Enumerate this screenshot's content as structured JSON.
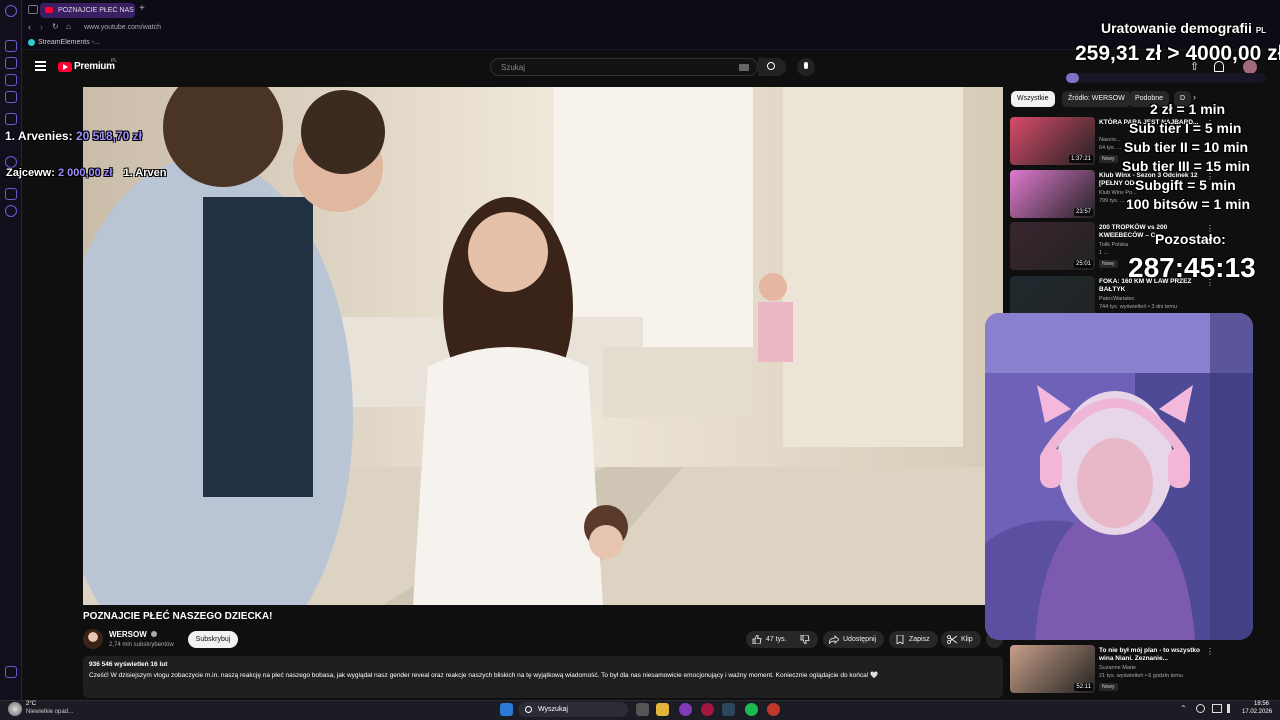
{
  "browser": {
    "tab_title": "POZNAJCIE PŁEĆ NAS",
    "url": "www.youtube.com/watch",
    "bookmark": "StreamElements -..."
  },
  "youtube": {
    "logo_text": "Premium",
    "logo_suffix": "PL",
    "search_placeholder": "Szukaj",
    "video_title": "POZNAJCIE PŁEĆ NASZEGO DZIECKA!",
    "channel_name": "WERSOW",
    "subscribers": "2,74 mln subskrybentów",
    "subscribe_label": "Subskrybuj",
    "likes": "47 tys.",
    "share_label": "Udostępnij",
    "save_label": "Zapisz",
    "clip_label": "Klip",
    "views_date": "936 546 wyświetleń  16 lut",
    "description": "Cześć! W dzisiejszym vlogu zobaczycie m.in. naszą reakcję na płeć naszego bobasa, jak wyglądał nasz gender reveal oraz reakcje naszych bliskich na tę wyjątkową wiadomość. To był dla nas niesamowicie emocjonujący i ważny moment. Koniecznie oglądajcie do końca! 🤍"
  },
  "sidebar": {
    "chips": [
      "Wszystkie",
      "Źródło: WERSOW",
      "Podobne",
      "D"
    ],
    "recs": [
      {
        "title": "KTÓRA PARA JEST NAJBARD...",
        "channel": "Nascio...",
        "meta": "64 tys. ...",
        "duration": "1:37:21",
        "badge": "Nowy"
      },
      {
        "title": "Klub Winx - Sezon 3 Odcinek 12 [PEŁNY ODC...",
        "channel": "Klub Winx Po...",
        "meta": "799 tys. ...",
        "duration": "23:57",
        "badge": ""
      },
      {
        "title": "200 TROPKÓW vs 200 KWEEBECÓW – C...",
        "channel": "Tolik Polska",
        "meta": "1 ...",
        "duration": "25:01",
        "badge": "Nowy"
      },
      {
        "title": "FOKA: 160 KM W LAW PRZEZ BAŁTYK",
        "channel": "PatecWariatec",
        "meta": "744 tys. wyświetleń • 3 dni temu",
        "duration": "",
        "badge": ""
      },
      {
        "title": "To nie był mój plan - to wszystko wina Niani. Zeznanie...",
        "channel": "Suzanne Marie",
        "meta": "21 tys. wyświetleń • 6 godzin temu",
        "duration": "52:11",
        "badge": "Nowy"
      }
    ]
  },
  "overlay": {
    "goal_title": "Uratowanie demografii",
    "goal_title_suffix": "PL",
    "goal_amount": "259,31 zł > 4000,00 zł",
    "goal_progress": 0.065,
    "top_donor_name": "1. Arvenies:",
    "top_donor_amount": "20 518,70 zł",
    "second_donor_name": "Zajceww:",
    "second_donor_amount": "2 000,00 zł",
    "ticker_tail": "1. Arven",
    "rates": [
      "2 zł = 1 min",
      "Sub tier I = 5 min",
      "Sub tier II = 10 min",
      "Sub tier III = 15 min",
      "Subgift = 5 min",
      "100 bitsów = 1 min"
    ],
    "remaining_label": "Pozostało:",
    "timer": "287:45:13"
  },
  "taskbar": {
    "weather_temp": "2°C",
    "weather_desc": "Niewielkie opad...",
    "search_label": "Wyszukaj",
    "time": "18:56",
    "date": "17.02.2026"
  },
  "colors": {
    "accent": "#6d5bd0",
    "yt_red": "#ff0033",
    "donor_amount": "#9d8cff"
  }
}
